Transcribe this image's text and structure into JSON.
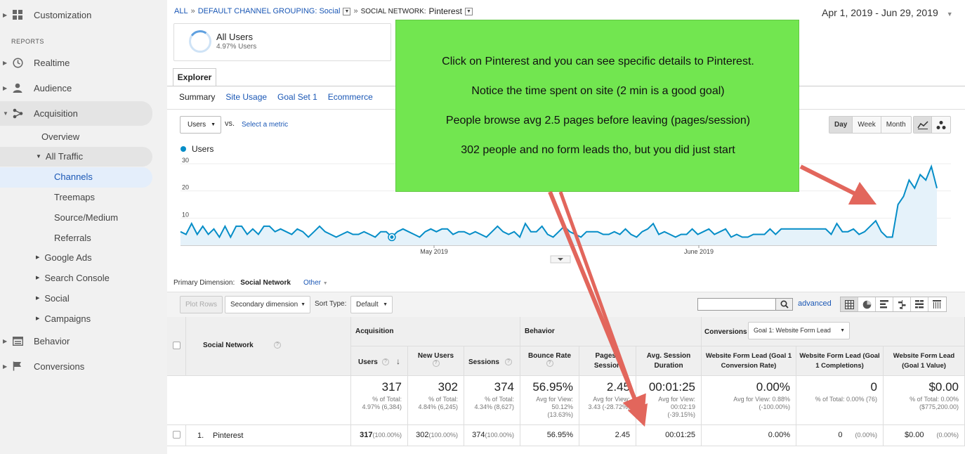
{
  "sidebar": {
    "customization": "Customization",
    "reports_header": "REPORTS",
    "realtime": "Realtime",
    "audience": "Audience",
    "acquisition": "Acquisition",
    "overview": "Overview",
    "all_traffic": "All Traffic",
    "channels": "Channels",
    "treemaps": "Treemaps",
    "source_medium": "Source/Medium",
    "referrals": "Referrals",
    "google_ads": "Google Ads",
    "search_console": "Search Console",
    "social": "Social",
    "campaigns": "Campaigns",
    "behavior": "Behavior",
    "conversions": "Conversions"
  },
  "breadcrumb": {
    "all": "ALL",
    "grouping": "DEFAULT CHANNEL GROUPING: Social",
    "network_label": "SOCIAL NETWORK:",
    "network_value": "Pinterest"
  },
  "date_range": "Apr 1, 2019 - Jun 29, 2019",
  "segment": {
    "name": "All Users",
    "pct": "4.97% Users"
  },
  "explorer_tab": "Explorer",
  "subtabs": [
    "Summary",
    "Site Usage",
    "Goal Set 1",
    "Ecommerce"
  ],
  "metric": {
    "selected": "Users",
    "vs": "vs.",
    "select_link": "Select a metric"
  },
  "granularity": {
    "day": "Day",
    "week": "Week",
    "month": "Month"
  },
  "legend": {
    "series": "Users",
    "color": "#058dc7"
  },
  "chart_data": {
    "type": "area",
    "series": [
      {
        "name": "Users",
        "values": [
          5,
          4,
          8,
          4,
          7,
          4,
          6,
          3,
          7,
          3,
          7,
          7,
          4,
          6,
          4,
          7,
          7,
          5,
          6,
          5,
          4,
          6,
          5,
          3,
          5,
          7,
          5,
          4,
          3,
          4,
          5,
          4,
          4,
          5,
          4,
          3,
          5,
          5,
          3,
          5,
          6,
          5,
          4,
          3,
          5,
          6,
          5,
          6,
          6,
          4,
          5,
          5,
          4,
          5,
          4,
          3,
          5,
          7,
          5,
          4,
          5,
          3,
          8,
          5,
          5,
          7,
          4,
          3,
          5,
          7,
          5,
          4,
          3,
          5,
          5,
          5,
          4,
          4,
          5,
          4,
          6,
          4,
          3,
          5,
          6,
          8,
          4,
          5,
          4,
          3,
          4,
          4,
          6,
          4,
          5,
          6,
          4,
          5,
          6,
          3,
          4,
          3,
          3,
          4,
          4,
          4,
          6,
          4,
          6,
          6,
          6,
          6,
          6,
          6,
          6,
          6,
          6,
          4,
          8,
          5,
          5,
          6,
          4,
          5,
          7,
          9,
          5,
          3,
          3,
          15,
          18,
          24,
          21,
          26,
          24,
          29,
          21
        ]
      }
    ],
    "yticks": [
      "10",
      "20",
      "30"
    ],
    "ylim": [
      0,
      30
    ],
    "xlabels": [
      "May 2019",
      "June 2019"
    ],
    "grid": true,
    "area_color": "#e5f2fa",
    "line_color": "#058dc7"
  },
  "primary_dimension": {
    "label": "Primary Dimension:",
    "current": "Social Network",
    "other": "Other"
  },
  "toolbar": {
    "plot_rows": "Plot Rows",
    "secondary": "Secondary dimension",
    "sort_label": "Sort Type:",
    "sort_value": "Default",
    "advanced": "advanced"
  },
  "table": {
    "dim_header": "Social Network",
    "groups": {
      "acquisition": "Acquisition",
      "behavior": "Behavior",
      "conversions": "Conversions",
      "goal_select": "Goal 1: Website Form Lead"
    },
    "columns": [
      "Users",
      "New Users",
      "Sessions",
      "Bounce Rate",
      "Pages / Session",
      "Avg. Session Duration",
      "Website Form Lead (Goal 1 Conversion Rate)",
      "Website Form Lead (Goal 1 Completions)",
      "Website Form Lead (Goal 1 Value)"
    ],
    "totals": [
      {
        "big": "317",
        "sm": "% of Total:\n4.97% (6,384)"
      },
      {
        "big": "302",
        "sm": "% of Total:\n4.84% (6,245)"
      },
      {
        "big": "374",
        "sm": "% of Total:\n4.34% (8,627)"
      },
      {
        "big": "56.95%",
        "sm": "Avg for View:\n50.12%\n(13.63%)"
      },
      {
        "big": "2.45",
        "sm": "Avg for View:\n3.43 (-28.72%)"
      },
      {
        "big": "00:01:25",
        "sm": "Avg for View:\n00:02:19\n(-39.15%)"
      },
      {
        "big": "0.00%",
        "sm": "Avg for View: 0.88%\n(-100.00%)"
      },
      {
        "big": "0",
        "sm": "% of Total: 0.00% (76)"
      },
      {
        "big": "$0.00",
        "sm": "% of Total: 0.00%\n($775,200.00)"
      }
    ],
    "row": {
      "index": "1.",
      "name": "Pinterest",
      "values": [
        {
          "v": "317",
          "p": "(100.00%)"
        },
        {
          "v": "302",
          "p": "(100.00%)"
        },
        {
          "v": "374",
          "p": "(100.00%)"
        },
        {
          "v": "56.95%",
          "p": ""
        },
        {
          "v": "2.45",
          "p": ""
        },
        {
          "v": "00:01:25",
          "p": ""
        },
        {
          "v": "0.00%",
          "p": ""
        },
        {
          "v": "0",
          "p": "(0.00%)"
        },
        {
          "v": "$0.00",
          "p": "(0.00%)"
        }
      ]
    }
  },
  "overlay": {
    "lines": [
      "Click on Pinterest and you can see specific details to Pinterest.",
      "Notice the time spent on site (2 min is a good goal)",
      "People browse avg 2.5 pages before leaving (pages/session)",
      "302 people and no form leads tho, but you did just start"
    ],
    "color": "#72e650",
    "arrow_color": "#e2665c"
  }
}
